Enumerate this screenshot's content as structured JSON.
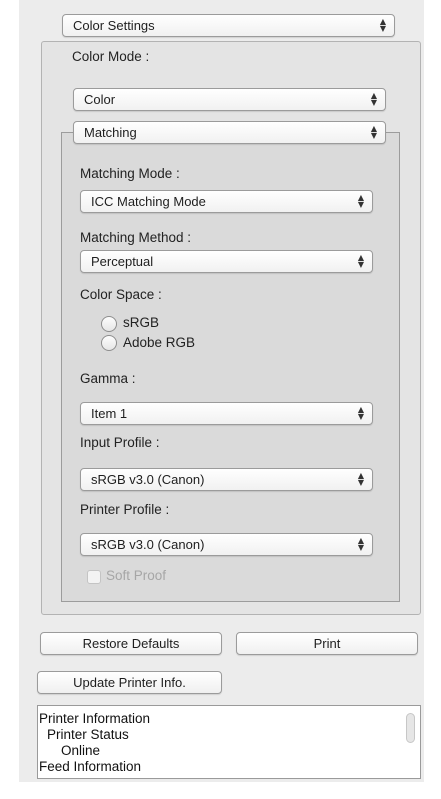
{
  "settings_menu": {
    "selected": "Color Settings"
  },
  "color_mode": {
    "label": "Color Mode :",
    "selected": "Color"
  },
  "matching_section": {
    "selected": "Matching"
  },
  "matching_mode": {
    "label": "Matching Mode :",
    "selected": "ICC Matching Mode"
  },
  "matching_method": {
    "label": "Matching Method :",
    "selected": "Perceptual"
  },
  "color_space": {
    "label": "Color Space :",
    "options": [
      "sRGB",
      "Adobe RGB"
    ]
  },
  "gamma": {
    "label": "Gamma :",
    "selected": "Item 1"
  },
  "input_profile": {
    "label": "Input Profile :",
    "selected": "sRGB v3.0 (Canon)"
  },
  "printer_profile": {
    "label": "Printer Profile :",
    "selected": "sRGB v3.0 (Canon)"
  },
  "soft_proof": {
    "label": "Soft Proof"
  },
  "buttons": {
    "restore_defaults": "Restore Defaults",
    "print": "Print",
    "update_printer_info": "Update Printer Info."
  },
  "info_list": {
    "lines": [
      "Printer Information",
      "Printer Status",
      "Online",
      "Feed Information"
    ]
  },
  "icons": {
    "popup_arrows": "↕",
    "arrow_glyph": "⌃⌄"
  }
}
